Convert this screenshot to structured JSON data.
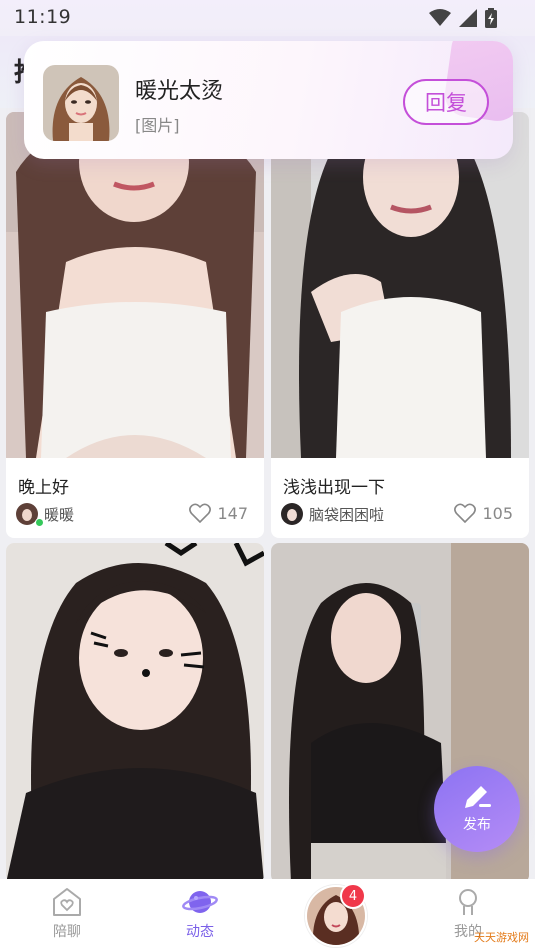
{
  "status_bar": {
    "time": "11:19"
  },
  "header": {
    "title": "推"
  },
  "notification": {
    "sender_name": "暖光太烫",
    "message": "[图片]",
    "reply_label": "回复"
  },
  "feed": [
    {
      "title": "晚上好",
      "author": "暖暖",
      "likes": "147",
      "author_online": true
    },
    {
      "title": "浅浅出现一下",
      "author": "脑袋困困啦",
      "likes": "105",
      "author_online": false
    },
    {
      "title": "",
      "author": "",
      "likes": ""
    },
    {
      "title": "",
      "author": "",
      "likes": ""
    }
  ],
  "fab": {
    "label": "发布",
    "icon": "pen-icon"
  },
  "tabbar": {
    "tabs": [
      {
        "label": "陪聊",
        "icon": "heart-house-icon",
        "active": false
      },
      {
        "label": "动态",
        "icon": "planet-icon",
        "active": true
      },
      {
        "label": "",
        "icon": "avatar",
        "active": false
      },
      {
        "label": "我的",
        "icon": "profile-icon",
        "active": false
      }
    ],
    "message_badge": "4"
  },
  "watermark": "天天游戏网",
  "colors": {
    "accent": "#7a5fe8",
    "reply": "#c44fd9",
    "badge": "#f0384a",
    "online": "#35c85a"
  }
}
